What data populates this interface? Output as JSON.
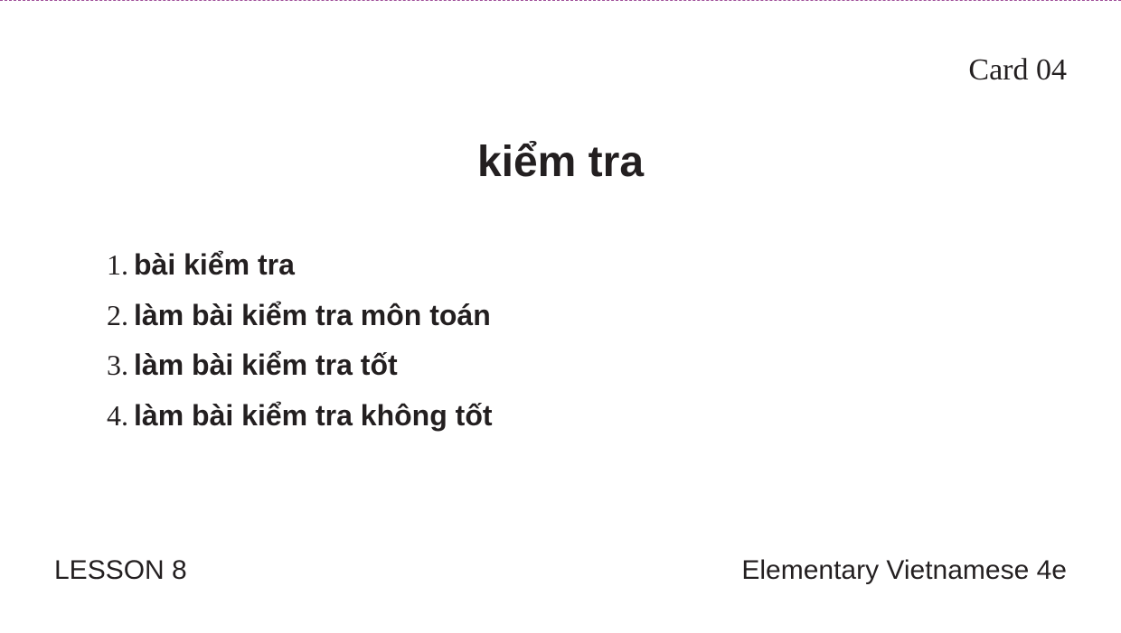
{
  "card": {
    "number_label": "Card 04",
    "headword": "kiểm tra",
    "examples": [
      {
        "num": "1.",
        "text": "bài kiểm tra"
      },
      {
        "num": "2.",
        "text": "làm bài kiểm tra môn toán"
      },
      {
        "num": "3.",
        "text": "làm bài kiểm tra tốt"
      },
      {
        "num": "4.",
        "text": "làm bài kiểm tra không tốt"
      }
    ],
    "footer": {
      "lesson": "LESSON 8",
      "book": "Elementary Vietnamese 4e"
    }
  },
  "colors": {
    "text": "#231f20",
    "cut_line": "#a0509a",
    "background": "#ffffff"
  }
}
